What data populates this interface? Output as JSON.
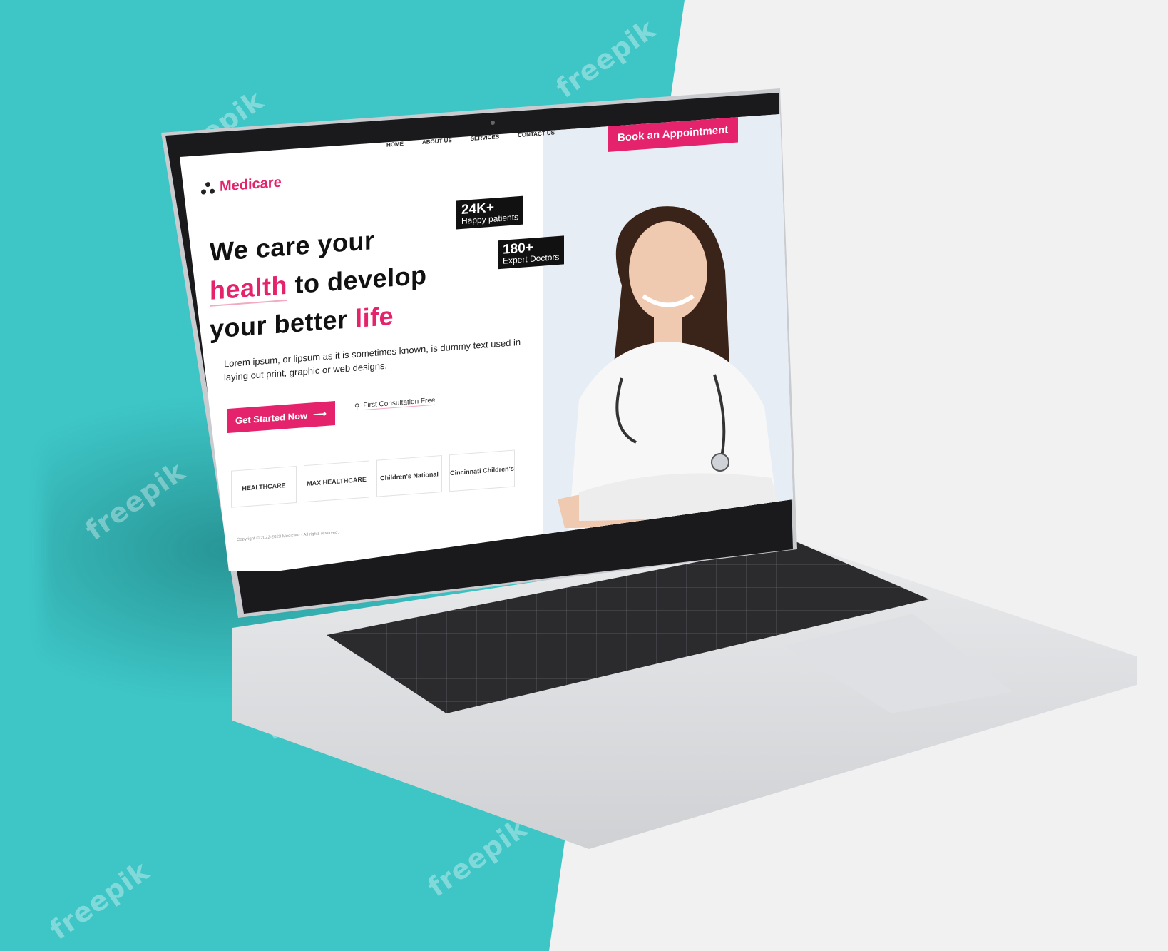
{
  "watermark": "freepik",
  "site": {
    "logo_text": "Medicare",
    "nav": [
      "HOME",
      "ABOUT US",
      "SERVICES",
      "CONTACT US"
    ],
    "book_button": "Book an Appointment",
    "headline": {
      "line1": "We care your",
      "line2_highlight": "health",
      "line2_rest": "to develop",
      "line3_start": "your better",
      "line3_highlight": "life"
    },
    "description": "Lorem ipsum, or lipsum as it is sometimes known, is dummy text used in laying out print, graphic or web designs.",
    "cta_button": "Get Started Now",
    "consultation_link": "First Consultation Free",
    "stats": [
      {
        "number": "24K+",
        "label": "Happy patients"
      },
      {
        "number": "180+",
        "label": "Expert Doctors"
      }
    ],
    "partners": [
      "HEALTHCARE",
      "MAX HEALTHCARE",
      "Children's National",
      "Cincinnati Children's"
    ],
    "copyright": "Copyright © 2022-2023 Medicare - All rights reserved."
  },
  "colors": {
    "accent": "#e5236c",
    "teal_background": "#3ec5c6",
    "dark": "#111111"
  }
}
